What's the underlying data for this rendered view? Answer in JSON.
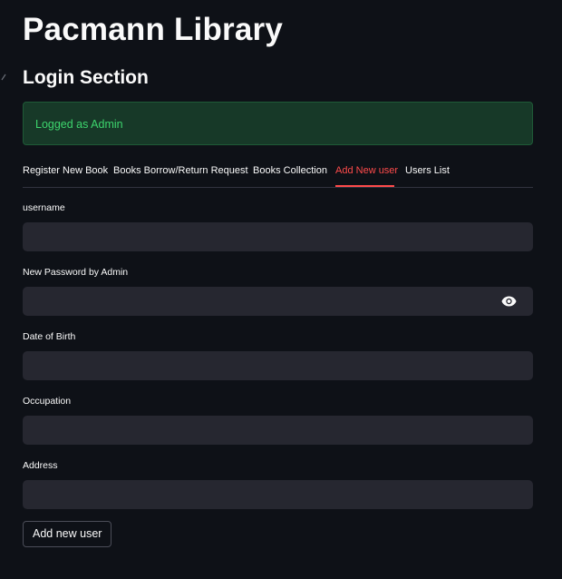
{
  "app": {
    "title": "Pacmann Library"
  },
  "section": {
    "title": "Login Section"
  },
  "alert": {
    "message": "Logged as Admin"
  },
  "tabs": [
    {
      "label": "Register New Book",
      "active": false
    },
    {
      "label": "Books Borrow/Return Request",
      "active": false
    },
    {
      "label": "Books Collection",
      "active": false
    },
    {
      "label": "Add New user",
      "active": true
    },
    {
      "label": "Users List",
      "active": false
    }
  ],
  "form": {
    "username": {
      "label": "username",
      "value": ""
    },
    "password": {
      "label": "New Password by Admin",
      "value": ""
    },
    "dob": {
      "label": "Date of Birth",
      "value": ""
    },
    "occupation": {
      "label": "Occupation",
      "value": ""
    },
    "address": {
      "label": "Address",
      "value": ""
    },
    "submit_label": "Add new user"
  },
  "colors": {
    "background": "#0e1117",
    "input_background": "#262730",
    "active_tab": "#ff4b4b",
    "success_text": "#3dd56d",
    "success_background": "#173928"
  },
  "icons": {
    "password_toggle": "eye-icon",
    "anchor": "link-icon"
  }
}
